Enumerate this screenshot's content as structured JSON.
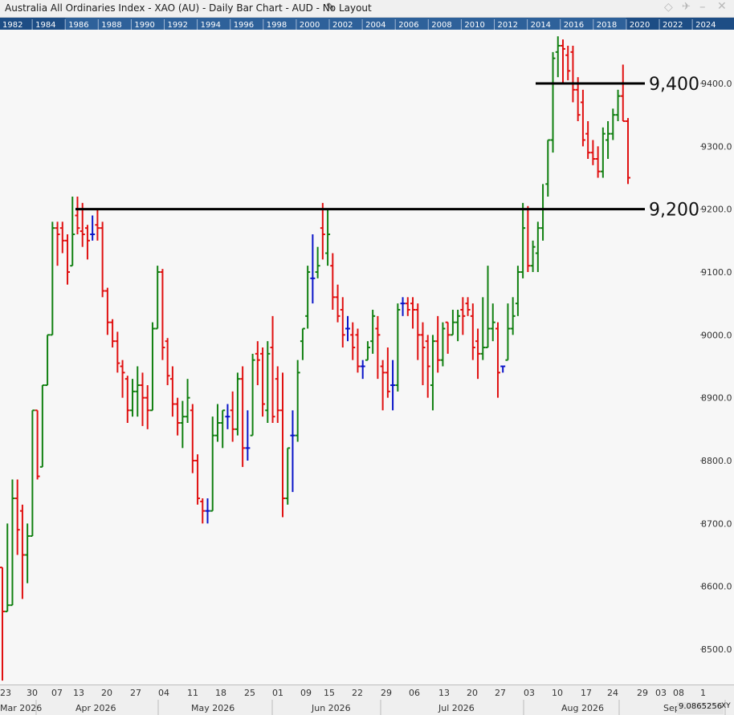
{
  "window": {
    "title": "Australia All Ordinaries Index - XAO (AU) - Daily Bar Chart - AUD - No Layout",
    "readout_value": "9.0865256",
    "readout_label": "XY"
  },
  "year_strip": {
    "labels": [
      "1982",
      "1984",
      "1986",
      "1988",
      "1990",
      "1992",
      "1994",
      "1996",
      "1998",
      "2000",
      "2002",
      "2004",
      "2006",
      "2008",
      "2010",
      "2012",
      "2014",
      "2016",
      "2018",
      "2020",
      "2022",
      "2024"
    ],
    "highlight_range": [
      "1986",
      "2020"
    ]
  },
  "colors": {
    "up": "#118011",
    "down": "#e01010",
    "neutral": "#0a14c8",
    "line": "#000000",
    "background": "#f7f7f7",
    "strip": "#1d4d85"
  },
  "chart_data": {
    "type": "bar",
    "subtype": "ohlc",
    "ylim": [
      8450,
      9500
    ],
    "ytick_values": [
      8500,
      8600,
      8700,
      8800,
      8900,
      9000,
      9100,
      9200,
      9300,
      9400
    ],
    "ytick_labels": [
      "8500.0",
      "8600.0",
      "8700.0",
      "8800.0",
      "8900.0",
      "9000.0",
      "9100.0",
      "9200.0",
      "9300.0",
      "9400.0"
    ],
    "grid": false,
    "x_day_labels": [
      "23",
      "30",
      "07",
      "13",
      "20",
      "27",
      "04",
      "11",
      "18",
      "25",
      "01",
      "09",
      "15",
      "22",
      "29",
      "06",
      "13",
      "20",
      "27",
      "03",
      "10",
      "17",
      "24",
      "29",
      "03",
      "08",
      "1"
    ],
    "x_month_labels": [
      "Mar 2026",
      "Apr 2026",
      "May 2026",
      "Jun 2026",
      "Jul 2026",
      "Aug 2026",
      "Sep"
    ],
    "horizontal_lines": [
      {
        "value": 9400,
        "label": "9,400"
      },
      {
        "value": 9200,
        "label": "9,200"
      }
    ],
    "series_ohlc": [
      [
        8630,
        8630,
        8450,
        8560
      ],
      [
        8560,
        8700,
        8560,
        8570
      ],
      [
        8570,
        8770,
        8570,
        8740
      ],
      [
        8740,
        8770,
        8650,
        8690
      ],
      [
        8720,
        8730,
        8580,
        8650
      ],
      [
        8650,
        8700,
        8605,
        8680
      ],
      [
        8680,
        8880,
        8680,
        8880
      ],
      [
        8880,
        8880,
        8770,
        8775
      ],
      [
        8790,
        8920,
        8790,
        8920
      ],
      [
        8920,
        9000,
        8920,
        9000
      ],
      [
        9000,
        9180,
        9000,
        9170
      ],
      [
        9170,
        9180,
        9110,
        9160
      ],
      [
        9170,
        9180,
        9130,
        9150
      ],
      [
        9150,
        9160,
        9080,
        9100
      ],
      [
        9110,
        9220,
        9110,
        9160
      ],
      [
        9190,
        9220,
        9160,
        9170
      ],
      [
        9165,
        9210,
        9140,
        9160
      ],
      [
        9170,
        9175,
        9120,
        9150
      ],
      [
        9160,
        9190,
        9150,
        9160
      ],
      [
        9175,
        9200,
        9150,
        9170
      ],
      [
        9170,
        9180,
        9060,
        9070
      ],
      [
        9070,
        9075,
        9000,
        9020
      ],
      [
        9020,
        9025,
        8980,
        8990
      ],
      [
        8990,
        9005,
        8940,
        8955
      ],
      [
        8950,
        8960,
        8900,
        8940
      ],
      [
        8930,
        8935,
        8860,
        8880
      ],
      [
        8880,
        8930,
        8870,
        8910
      ],
      [
        8910,
        8950,
        8870,
        8920
      ],
      [
        8920,
        8940,
        8855,
        8900
      ],
      [
        8900,
        8920,
        8850,
        8880
      ],
      [
        8880,
        9020,
        8880,
        9010
      ],
      [
        9010,
        9110,
        9010,
        9100
      ],
      [
        9100,
        9105,
        8960,
        8980
      ],
      [
        8990,
        8995,
        8920,
        8935
      ],
      [
        8930,
        8950,
        8870,
        8890
      ],
      [
        8890,
        8900,
        8840,
        8860
      ],
      [
        8860,
        8895,
        8820,
        8870
      ],
      [
        8870,
        8930,
        8860,
        8900
      ],
      [
        8880,
        8890,
        8780,
        8800
      ],
      [
        8800,
        8810,
        8730,
        8740
      ],
      [
        8735,
        8740,
        8700,
        8720
      ],
      [
        8720,
        8740,
        8700,
        8720
      ],
      [
        8720,
        8870,
        8720,
        8840
      ],
      [
        8840,
        8890,
        8830,
        8860
      ],
      [
        8860,
        8880,
        8820,
        8880
      ],
      [
        8870,
        8890,
        8850,
        8870
      ],
      [
        8880,
        8910,
        8830,
        8850
      ],
      [
        8850,
        8940,
        8840,
        8930
      ],
      [
        8930,
        8950,
        8790,
        8820
      ],
      [
        8820,
        8880,
        8800,
        8820
      ],
      [
        8840,
        8970,
        8840,
        8960
      ],
      [
        8970,
        8990,
        8920,
        8960
      ],
      [
        8970,
        8980,
        8870,
        8890
      ],
      [
        8880,
        8990,
        8860,
        8970
      ],
      [
        8980,
        9030,
        8860,
        8870
      ],
      [
        8930,
        8950,
        8860,
        8880
      ],
      [
        8880,
        8940,
        8710,
        8740
      ],
      [
        8740,
        8820,
        8730,
        8820
      ],
      [
        8840,
        8880,
        8750,
        8840
      ],
      [
        8840,
        8960,
        8830,
        8940
      ],
      [
        8990,
        9010,
        8960,
        9010
      ],
      [
        9030,
        9110,
        9010,
        9100
      ],
      [
        9090,
        9160,
        9050,
        9090
      ],
      [
        9100,
        9140,
        9090,
        9110
      ],
      [
        9170,
        9210,
        9120,
        9160
      ],
      [
        9130,
        9200,
        9110,
        9160
      ],
      [
        9110,
        9130,
        9040,
        9060
      ],
      [
        9060,
        9080,
        9020,
        9030
      ],
      [
        9040,
        9060,
        8980,
        9000
      ],
      [
        9010,
        9030,
        8990,
        9010
      ],
      [
        9000,
        9020,
        8960,
        8980
      ],
      [
        9000,
        9010,
        8940,
        8950
      ],
      [
        8950,
        8960,
        8930,
        8950
      ],
      [
        8960,
        8990,
        8960,
        8980
      ],
      [
        8990,
        9040,
        8970,
        9030
      ],
      [
        9010,
        9030,
        8930,
        9000
      ],
      [
        8950,
        8960,
        8880,
        8940
      ],
      [
        8940,
        8980,
        8900,
        8910
      ],
      [
        8920,
        8960,
        8880,
        8920
      ],
      [
        8920,
        9050,
        8910,
        9040
      ],
      [
        9050,
        9060,
        9030,
        9050
      ],
      [
        9050,
        9060,
        9030,
        9040
      ],
      [
        9050,
        9060,
        9010,
        9040
      ],
      [
        9040,
        9050,
        8960,
        9000
      ],
      [
        9000,
        9020,
        8920,
        8980
      ],
      [
        8990,
        9000,
        8900,
        8950
      ],
      [
        8920,
        9000,
        8880,
        8990
      ],
      [
        8990,
        9030,
        8940,
        8960
      ],
      [
        8960,
        9020,
        8950,
        9010
      ],
      [
        9020,
        9020,
        8970,
        9000
      ],
      [
        9000,
        9040,
        9000,
        9020
      ],
      [
        9020,
        9040,
        8990,
        9030
      ],
      [
        9040,
        9060,
        9000,
        9030
      ],
      [
        9050,
        9060,
        9030,
        9040
      ],
      [
        9030,
        9050,
        8960,
        8980
      ],
      [
        8990,
        9010,
        8930,
        8970
      ],
      [
        8970,
        9060,
        8960,
        8980
      ],
      [
        8980,
        9110,
        8980,
        9010
      ],
      [
        9010,
        9050,
        8990,
        9020
      ],
      [
        9010,
        9020,
        8900,
        8940
      ],
      [
        8950,
        8950,
        8940,
        8950
      ],
      [
        8960,
        9050,
        8960,
        9010
      ],
      [
        9010,
        9060,
        9000,
        9030
      ],
      [
        9050,
        9110,
        9030,
        9100
      ],
      [
        9100,
        9210,
        9090,
        9170
      ],
      [
        9200,
        9205,
        9100,
        9110
      ],
      [
        9110,
        9150,
        9100,
        9140
      ],
      [
        9130,
        9180,
        9100,
        9170
      ],
      [
        9170,
        9240,
        9150,
        9200
      ],
      [
        9240,
        9310,
        9220,
        9310
      ],
      [
        9310,
        9450,
        9290,
        9440
      ],
      [
        9450,
        9475,
        9410,
        9460
      ],
      [
        9460,
        9470,
        9400,
        9455
      ],
      [
        9445,
        9460,
        9405,
        9420
      ],
      [
        9450,
        9460,
        9370,
        9390
      ],
      [
        9390,
        9410,
        9340,
        9350
      ],
      [
        9370,
        9390,
        9300,
        9310
      ],
      [
        9320,
        9340,
        9280,
        9290
      ],
      [
        9290,
        9310,
        9270,
        9280
      ],
      [
        9280,
        9300,
        9250,
        9260
      ],
      [
        9260,
        9330,
        9250,
        9320
      ],
      [
        9310,
        9340,
        9280,
        9320
      ],
      [
        9320,
        9360,
        9310,
        9350
      ],
      [
        9350,
        9390,
        9340,
        9380
      ],
      [
        9380,
        9430,
        9340,
        9340
      ],
      [
        9340,
        9345,
        9240,
        9250
      ]
    ]
  }
}
